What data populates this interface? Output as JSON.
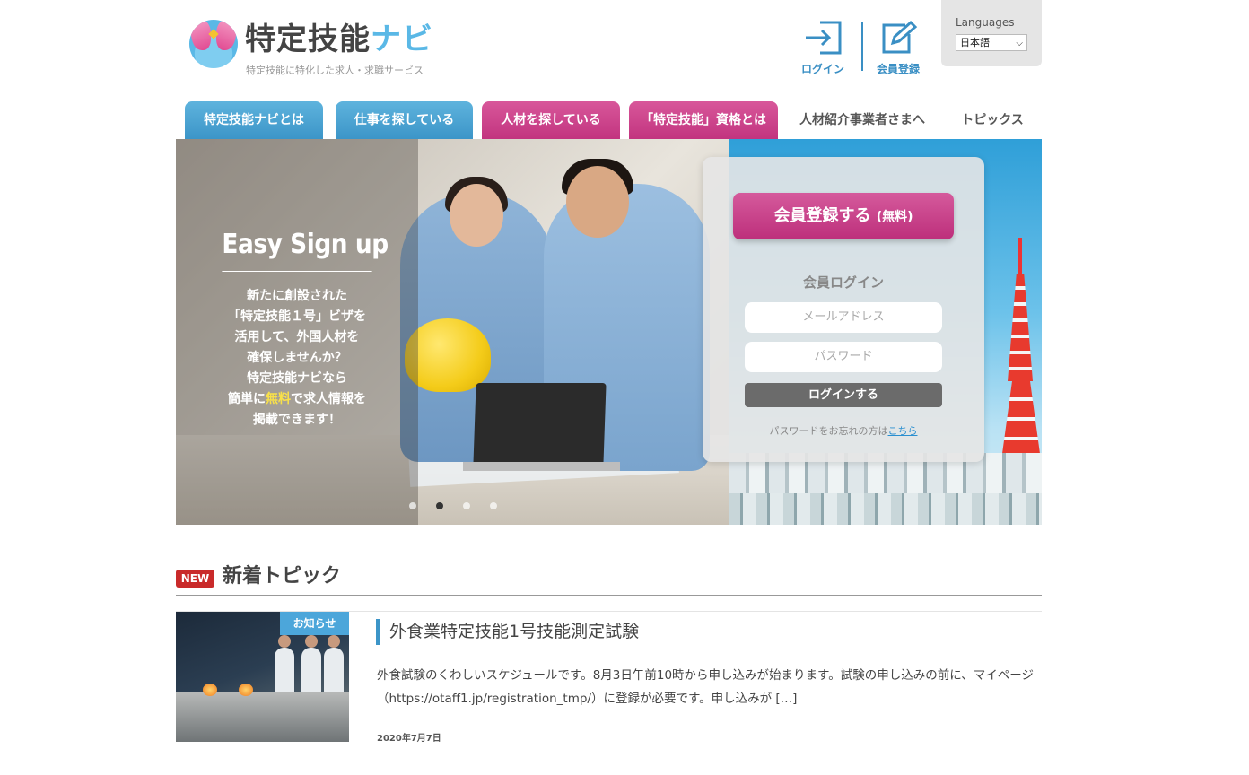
{
  "header": {
    "logo_title_main": "特定技能",
    "logo_title_accent": "ナビ",
    "logo_subtitle": "特定技能に特化した求人・求職サービス",
    "login_label": "ログイン",
    "register_label": "会員登録",
    "languages_label": "Languages",
    "language_selected": "日本語",
    "icons": {
      "login": "login-icon",
      "register": "edit-icon",
      "dropdown": "chevron-down-icon"
    },
    "accent_color": "#3a8fc4"
  },
  "nav": {
    "tabs": [
      {
        "label": "特定技能ナビとは",
        "style": "blue"
      },
      {
        "label": "仕事を探している",
        "style": "blue"
      },
      {
        "label": "人材を探している",
        "style": "pink"
      },
      {
        "label": "「特定技能」資格とは",
        "style": "pink"
      },
      {
        "label": "人材紹介事業者さまへ",
        "style": "plain"
      },
      {
        "label": "トピックス",
        "style": "plain"
      }
    ],
    "colors": {
      "blue": "#3c95c8",
      "pink": "#c2347f"
    }
  },
  "hero": {
    "heading": "Easy Sign up",
    "body_lines": [
      "新たに創設された",
      "「特定技能１号」ビザを",
      "活用して、外国人材を",
      "確保しませんか？",
      "特定技能ナビなら"
    ],
    "body_line6_pre": "簡単に",
    "body_line6_highlight": "無料",
    "body_line6_post": "で求人情報を",
    "body_line7": "掲載できます！",
    "highlight_color": "#f8e04a",
    "slider": {
      "count": 4,
      "active_index": 2
    }
  },
  "login_panel": {
    "register_button_label": "会員登録する",
    "register_button_suffix": "(無料)",
    "login_title": "会員ログイン",
    "email_placeholder": "メールアドレス",
    "password_placeholder": "パスワード",
    "login_button_label": "ログインする",
    "forgot_text": "パスワードをお忘れの方は",
    "forgot_link": "こちら"
  },
  "topics": {
    "badge": "NEW",
    "title": "新着トピック",
    "items": [
      {
        "tag": "お知らせ",
        "title": "外食業特定技能1号技能測定試験",
        "body": "外食試験のくわしいスケジュールです。8月3日午前10時から申し込みが始まります。試験の申し込みの前に、マイページ（https://otaff1.jp/registration_tmp/）に登録が必要です。申し込みが […]",
        "date": "2020年7月7日"
      }
    ]
  }
}
